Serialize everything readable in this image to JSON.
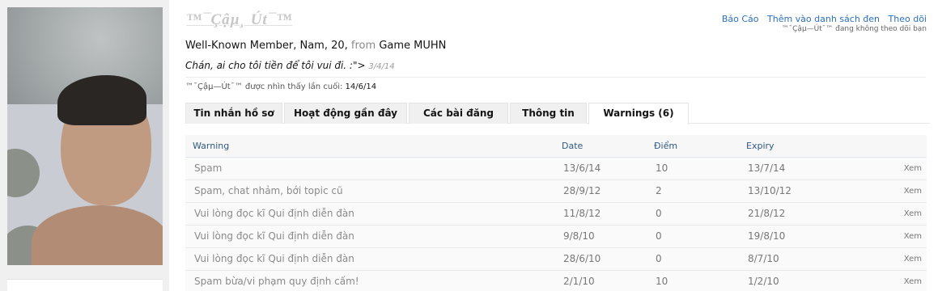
{
  "profile": {
    "username": "™¯Çậµ¸ Út¯™",
    "blurb_prefix": "Well-Known Member, Nam, 20,",
    "blurb_from": "from",
    "blurb_location": "Game MUHN",
    "status_text": "Chán, ai cho tôi tiền để tôi vui đi. :\">",
    "status_date": "3/4/14",
    "last_seen_label": "™¯Çậµ—Út¯™ được nhìn thấy lần cuối:",
    "last_seen_value": "14/6/14"
  },
  "topnav": {
    "report": "Báo Cáo",
    "ignore": "Thêm vào danh sách đen",
    "follow": "Theo dõi",
    "follow_note": "™¯Çậµ—Út¯™ đang không theo dõi bạn"
  },
  "tabs": [
    {
      "label": "Tin nhắn hồ sơ"
    },
    {
      "label": "Hoạt động gần đây"
    },
    {
      "label": "Các bài đăng"
    },
    {
      "label": "Thông tin"
    },
    {
      "label": "Warnings (6)"
    }
  ],
  "warnings": {
    "headers": [
      "Warning",
      "Date",
      "Điểm",
      "Expiry"
    ],
    "action_label": "Xem",
    "rows": [
      {
        "warning": "Spam",
        "date": "13/6/14",
        "points": "10",
        "expiry": "13/7/14"
      },
      {
        "warning": "Spam, chat nhảm, bới topic cũ",
        "date": "28/9/12",
        "points": "2",
        "expiry": "13/10/12"
      },
      {
        "warning": "Vui lòng đọc kĩ Qui định diễn đàn",
        "date": "11/8/12",
        "points": "0",
        "expiry": "21/8/12"
      },
      {
        "warning": "Vui lòng đọc kĩ Qui định diễn đàn",
        "date": "9/8/10",
        "points": "0",
        "expiry": "19/8/10"
      },
      {
        "warning": "Vui lòng đọc kĩ Qui định diễn đàn",
        "date": "28/6/10",
        "points": "0",
        "expiry": "8/7/10"
      },
      {
        "warning": "Spam bừa/vi phạm quy định cấm!",
        "date": "2/1/10",
        "points": "10",
        "expiry": "1/2/10"
      }
    ]
  },
  "colors": {
    "link": "#2a6fbf",
    "header_text": "#2f5a84",
    "username": "#c7c7c7"
  }
}
